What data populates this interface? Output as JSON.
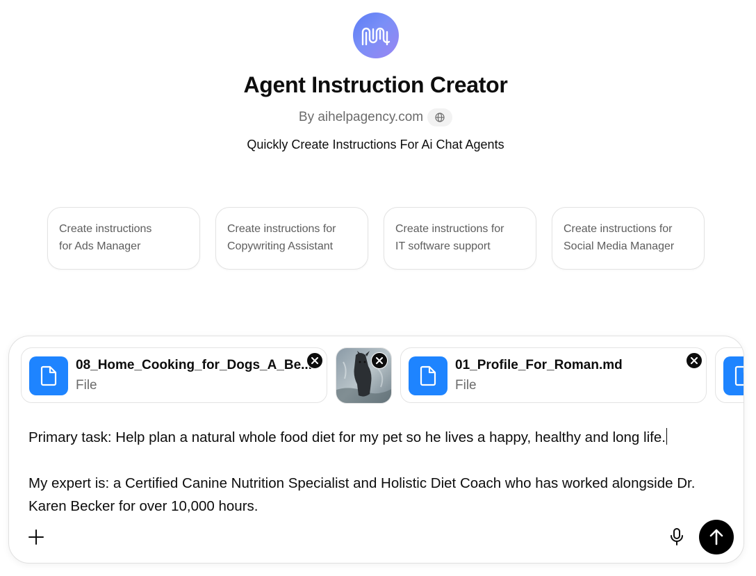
{
  "header": {
    "logo_icon": "fingerprint-wave-icon",
    "title": "Agent Instruction Creator",
    "byline": "By aihelpagency.com",
    "globe_icon": "globe-icon",
    "tagline": "Quickly Create Instructions For Ai Chat Agents"
  },
  "suggestions": [
    {
      "line1": "Create instructions",
      "line2": "for Ads Manager"
    },
    {
      "line1": "Create instructions for",
      "line2": "Copywriting Assistant"
    },
    {
      "line1": "Create instructions for",
      "line2": "IT software support"
    },
    {
      "line1": "Create instructions for",
      "line2": "Social Media Manager"
    }
  ],
  "composer": {
    "attachments": [
      {
        "name": "08_Home_Cooking_for_Dogs_A_Be...",
        "type": "File",
        "icon": "document-icon"
      },
      {
        "name": "01_Profile_For_Roman.md",
        "type": "File",
        "icon": "document-icon"
      }
    ],
    "image_attachment": "dog-photo-thumbnail",
    "text_line1": "Primary task: Help plan a natural whole food diet for my pet so he lives a happy, healthy and long life.",
    "text_line2": "My expert is: a Certified Canine Nutrition Specialist and Holistic Diet Coach who has worked alongside Dr. Karen Becker for over 10,000 hours.",
    "icons": {
      "add": "plus-icon",
      "voice": "microphone-icon",
      "send": "arrow-up-icon"
    },
    "colors": {
      "file_icon_bg": "#1e84ff",
      "send_bg": "#000000"
    }
  }
}
